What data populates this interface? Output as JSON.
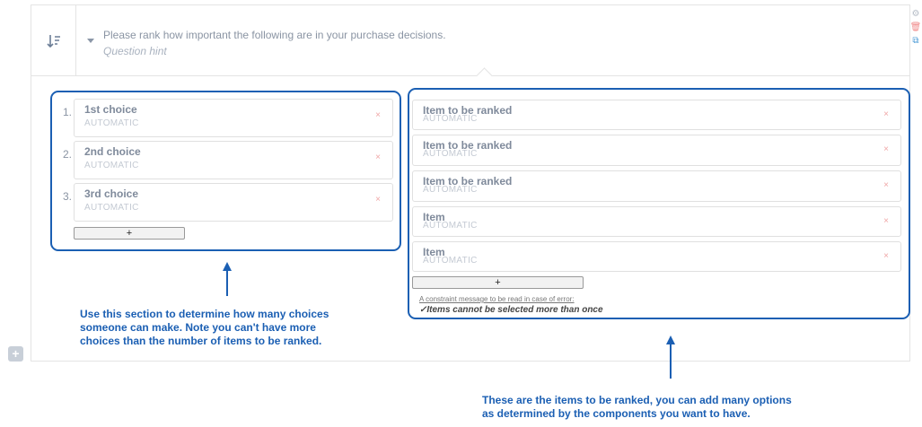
{
  "question": {
    "label": "Please rank how important the following are in your purchase decisions.",
    "hint": "Question hint"
  },
  "choices": [
    {
      "num": "1.",
      "label": "1st choice",
      "sub": "AUTOMATIC",
      "remove": "×"
    },
    {
      "num": "2.",
      "label": "2nd choice",
      "sub": "AUTOMATIC",
      "remove": "×"
    },
    {
      "num": "3.",
      "label": "3rd choice",
      "sub": "AUTOMATIC",
      "remove": "×"
    }
  ],
  "choices_add": "+",
  "items": [
    {
      "label": "Item to be ranked",
      "sub": "AUTOMATIC",
      "remove": "×"
    },
    {
      "label": "Item to be ranked",
      "sub": "AUTOMATIC",
      "remove": "×"
    },
    {
      "label": "Item to be ranked",
      "sub": "AUTOMATIC",
      "remove": "×"
    },
    {
      "label": "Item",
      "sub": "AUTOMATIC",
      "remove": "×"
    },
    {
      "label": "Item",
      "sub": "AUTOMATIC",
      "remove": "×"
    }
  ],
  "items_add": "+",
  "constraint": {
    "message": "A constraint message to be read in case of error:",
    "rule": "✓Items cannot be selected more than once"
  },
  "side_icons": [
    "gear-icon",
    "trash-icon",
    "copy-icon"
  ],
  "add_question": "+",
  "annotations": {
    "left_note": [
      "Use this section to determine how many choices",
      "someone can make. Note you can't have more",
      "choices than the number of items to be ranked."
    ],
    "right_note": [
      "These are the items to be ranked, you can add many options",
      "as determined by the components you want to have."
    ]
  },
  "colors": {
    "accent": "#1b5fb3",
    "remove": "#f0a6a6",
    "muted_text": "#8a94a3"
  }
}
